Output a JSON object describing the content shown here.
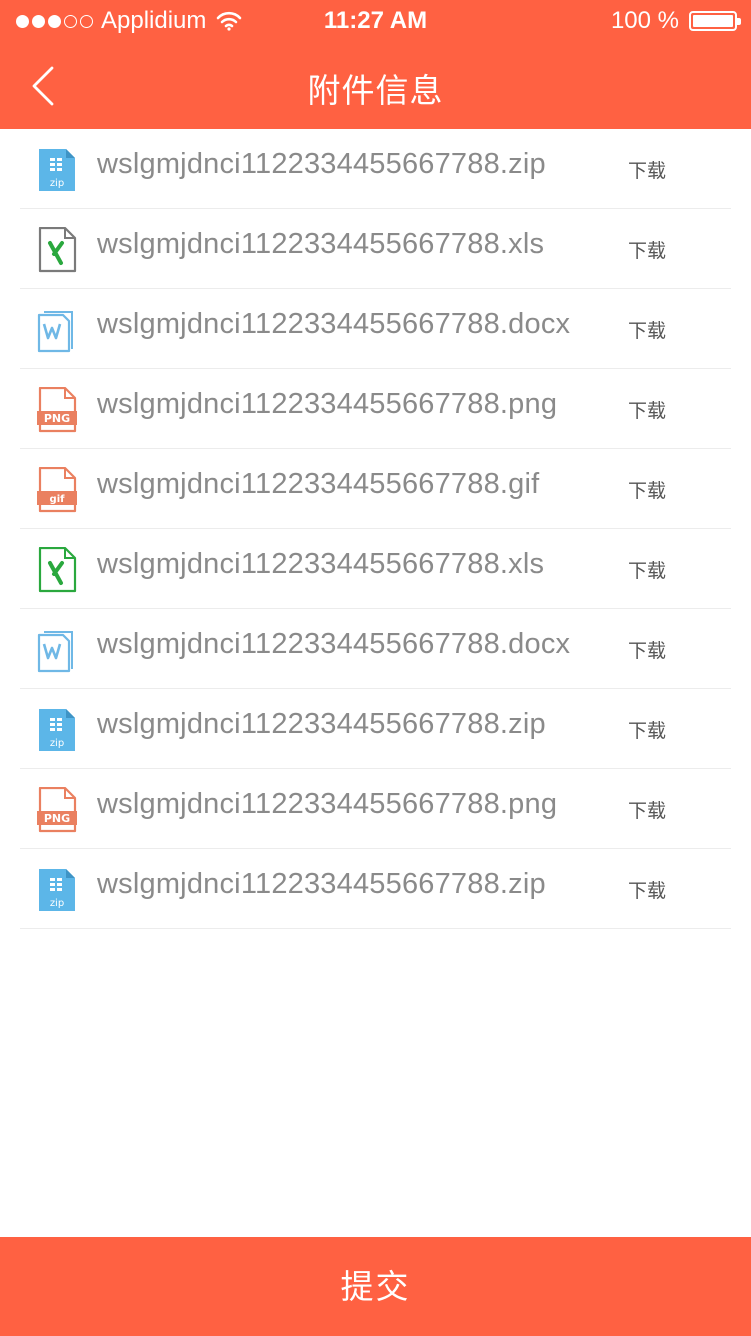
{
  "status_bar": {
    "carrier": "Applidium",
    "time": "11:27 AM",
    "battery": "100 %"
  },
  "nav": {
    "title": "附件信息"
  },
  "files": [
    {
      "name": "wslgmjdnci1122334455667788.zip",
      "type": "zip",
      "download_label": "下载"
    },
    {
      "name": "wslgmjdnci1122334455667788.xls",
      "type": "xls-gray",
      "download_label": "下载"
    },
    {
      "name": "wslgmjdnci1122334455667788.docx",
      "type": "docx",
      "download_label": "下载"
    },
    {
      "name": "wslgmjdnci1122334455667788.png",
      "type": "png",
      "download_label": "下载"
    },
    {
      "name": "wslgmjdnci1122334455667788.gif",
      "type": "gif",
      "download_label": "下载"
    },
    {
      "name": "wslgmjdnci1122334455667788.xls",
      "type": "xls",
      "download_label": "下载"
    },
    {
      "name": "wslgmjdnci1122334455667788.docx",
      "type": "docx",
      "download_label": "下载"
    },
    {
      "name": "wslgmjdnci1122334455667788.zip",
      "type": "zip",
      "download_label": "下载"
    },
    {
      "name": "wslgmjdnci1122334455667788.png",
      "type": "png",
      "download_label": "下载"
    },
    {
      "name": "wslgmjdnci1122334455667788.zip",
      "type": "zip",
      "download_label": "下载"
    }
  ],
  "icon_labels": {
    "zip": "zip",
    "png": "PNG",
    "gif": "gif"
  },
  "submit": {
    "label": "提交"
  },
  "colors": {
    "accent": "#ff6142",
    "zip": "#5cb6e8",
    "word": "#6fb8e6",
    "excel_green": "#2aa83e",
    "excel_gray": "#7a7a7a",
    "image": "#ea8060"
  }
}
